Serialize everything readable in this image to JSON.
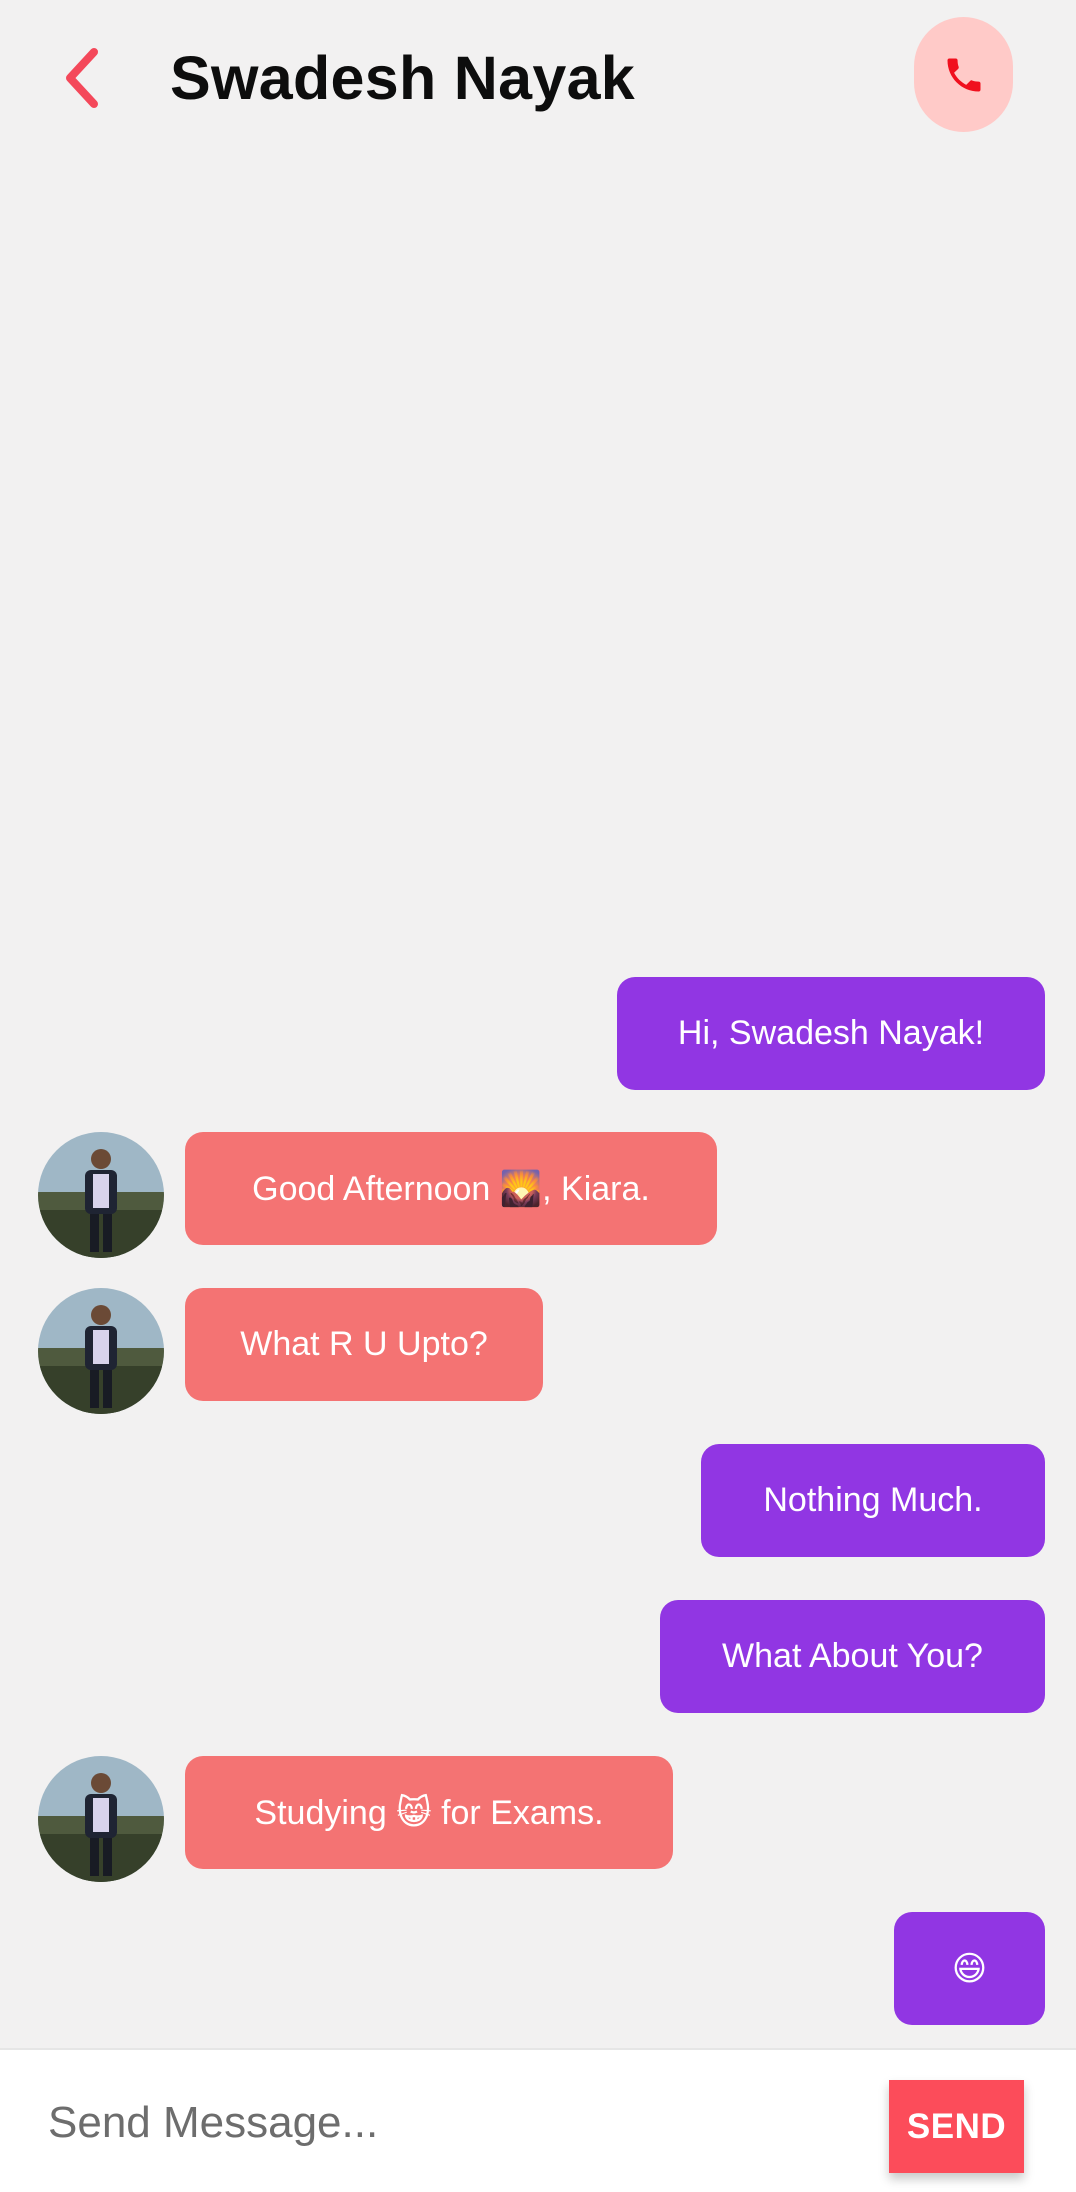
{
  "header": {
    "title": "Swadesh Nayak",
    "back_icon": "chevron-left-icon",
    "call_icon": "phone-icon"
  },
  "messages": [
    {
      "from": "me",
      "text": "Hi, Swadesh Nayak!"
    },
    {
      "from": "contact",
      "text": "Good Afternoon 🌄, Kiara."
    },
    {
      "from": "contact",
      "text": "What R U Upto?"
    },
    {
      "from": "me",
      "text": "Nothing Much."
    },
    {
      "from": "me",
      "text": "What About You?"
    },
    {
      "from": "contact",
      "text": "Studying 😸 for Exams."
    },
    {
      "from": "me",
      "text": "😄"
    }
  ],
  "composer": {
    "placeholder": "Send Message...",
    "send_label": "SEND"
  },
  "colors": {
    "background": "#f2f1f1",
    "accent": "#fc4c5a",
    "sent_bubble": "#9136e3",
    "received_bubble": "#f47373",
    "call_button_bg": "#ffcac8"
  }
}
